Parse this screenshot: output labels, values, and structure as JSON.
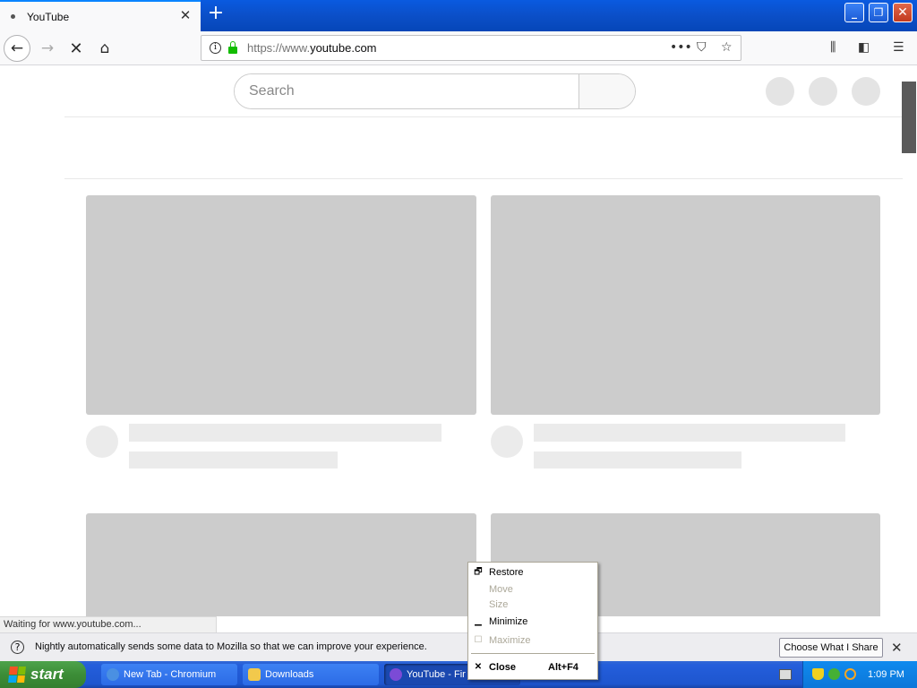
{
  "browser": {
    "tab": {
      "title": "YouTube"
    },
    "new_tab_symbol": "+",
    "window_controls": {
      "minimize": "_",
      "restore": "❐",
      "close": "✕"
    },
    "nav": {
      "back": "←",
      "forward": "→",
      "stop": "✕",
      "home": "⌂"
    },
    "url": {
      "prefix": "https://www.",
      "domain": "youtube.com"
    },
    "url_icons": {
      "info": "i",
      "more": "•••",
      "pocket": "⛉",
      "bookmark": "☆"
    },
    "toolbar_icons": {
      "library": "⫼",
      "sidebar": "◧",
      "menu": "☰"
    }
  },
  "page": {
    "search_placeholder": "Search"
  },
  "status_text": "Waiting for www.youtube.com...",
  "notification": {
    "icon": "?",
    "message": "Nightly automatically sends some data to Mozilla so that we can improve your experience.",
    "button": "Choose What I Share",
    "close": "✕"
  },
  "taskbar": {
    "start_label": "start",
    "tasks": [
      {
        "label": "New Tab - Chromium",
        "icon_color": "#4a90e2"
      },
      {
        "label": "Downloads",
        "icon_color": "#f2c94c"
      },
      {
        "label": "YouTube - Fir",
        "icon_color": "#7b4bd6"
      }
    ],
    "clock": "1:09 PM"
  },
  "context_menu": {
    "items": [
      {
        "label": "Restore",
        "icon": "🗗",
        "enabled": true
      },
      {
        "label": "Move",
        "enabled": false
      },
      {
        "label": "Size",
        "enabled": false
      },
      {
        "label": "Minimize",
        "icon": "▁",
        "enabled": true
      },
      {
        "label": "Maximize",
        "icon": "☐",
        "enabled": false
      },
      {
        "label": "Close",
        "icon": "✕",
        "accelerator": "Alt+F4",
        "enabled": true
      }
    ]
  },
  "colors": {
    "titlebar": "#0b4fc8",
    "skeleton": "#cccccc",
    "taskbar": "#245edb",
    "start": "#3c8d37"
  }
}
